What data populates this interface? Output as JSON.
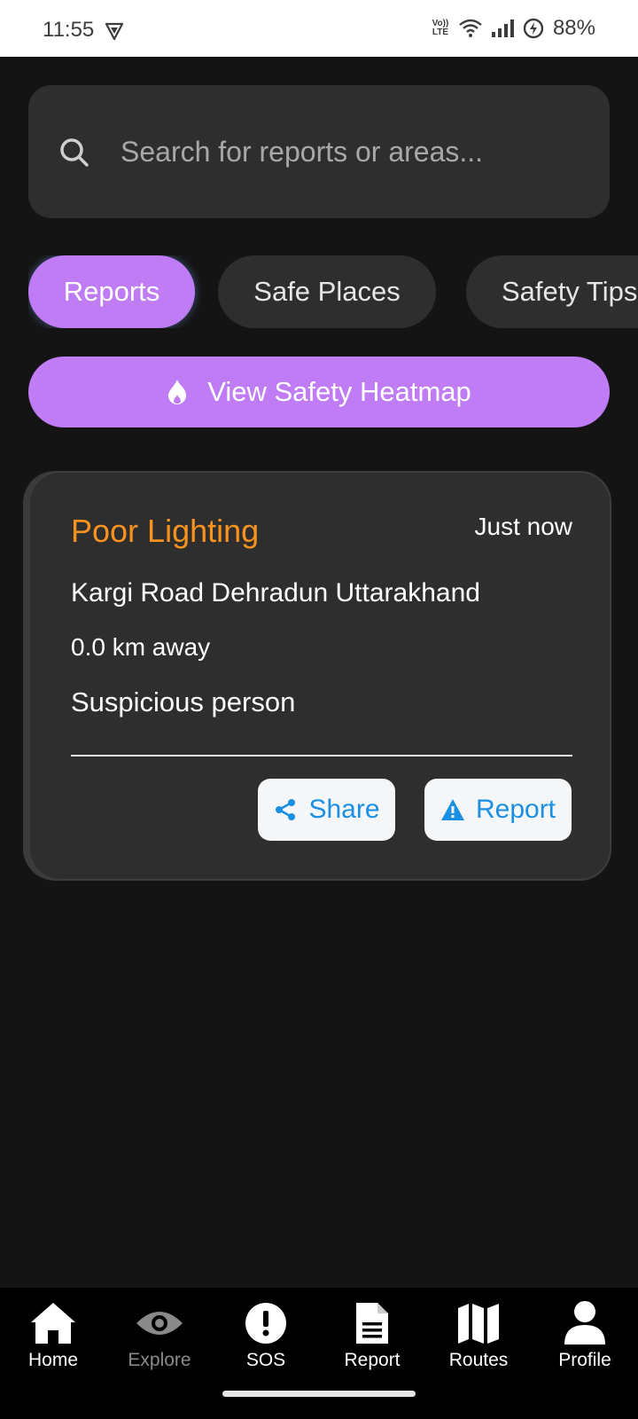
{
  "status_bar": {
    "time": "11:55",
    "volte_label": "Vo)) LTE",
    "battery_percent": "88%"
  },
  "search": {
    "placeholder": "Search for reports or areas...",
    "value": ""
  },
  "tabs": [
    {
      "label": "Reports",
      "active": true
    },
    {
      "label": "Safe Places",
      "active": false
    },
    {
      "label": "Safety Tips",
      "active": false
    }
  ],
  "heatmap_button": {
    "label": "View Safety Heatmap",
    "icon": "flame-icon"
  },
  "report_card": {
    "type": "Poor Lighting",
    "time": "Just now",
    "address": "Kargi Road Dehradun Uttarakhand",
    "distance": "0.0 km away",
    "description": "Suspicious person",
    "share_label": "Share",
    "report_label": "Report"
  },
  "bottom_nav": [
    {
      "label": "Home",
      "icon": "home-icon"
    },
    {
      "label": "Explore",
      "icon": "eye-icon"
    },
    {
      "label": "SOS",
      "icon": "sos-icon"
    },
    {
      "label": "Report",
      "icon": "document-icon"
    },
    {
      "label": "Routes",
      "icon": "map-icon"
    },
    {
      "label": "Profile",
      "icon": "user-icon"
    }
  ],
  "colors": {
    "accent_purple": "#bf7cf5",
    "warning_orange": "#f7931e",
    "action_blue": "#1a8fe3",
    "background": "#141414",
    "surface": "#2e2e2e"
  }
}
